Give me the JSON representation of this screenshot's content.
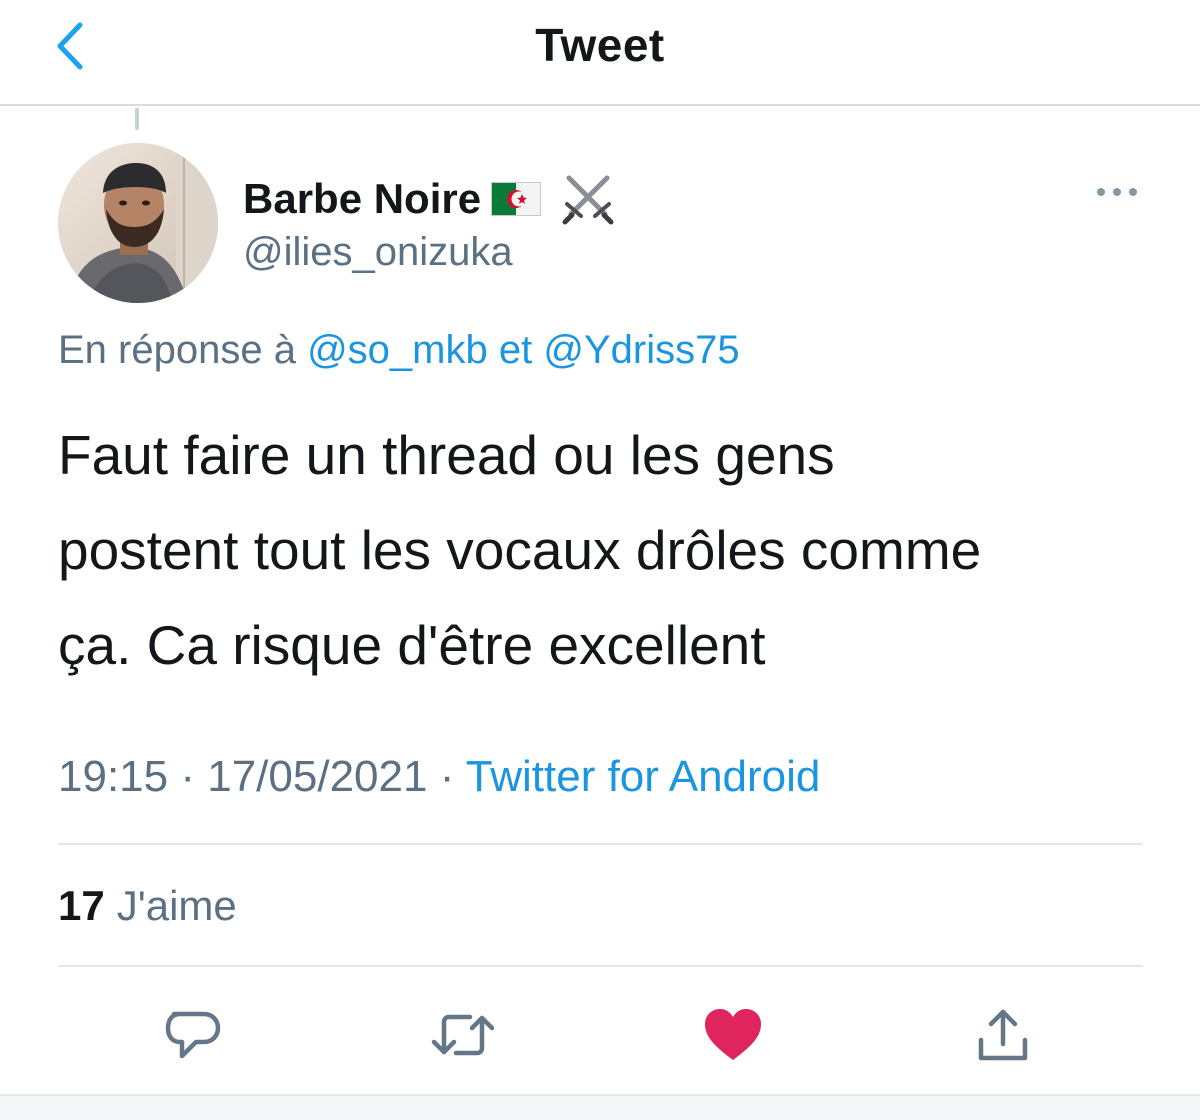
{
  "header": {
    "title": "Tweet",
    "back_icon": "chevron-left-icon",
    "accent": "#1da1f2"
  },
  "tweet": {
    "author": {
      "name": "Barbe Noire",
      "flag_icon": "algeria-flag-icon",
      "emoji_icon": "crossed-swords-icon",
      "handle": "@ilies_onizuka"
    },
    "more_icon": "more-horizontal-icon",
    "reply_context": {
      "prefix": "En réponse à",
      "mention_1": "@so_mkb",
      "joiner": "et",
      "mention_2": "@Ydriss75"
    },
    "text_lines": [
      "Faut faire un thread ou les gens",
      "postent tout les vocaux drôles comme",
      "ça. Ca risque d'être excellent"
    ],
    "time": "19:15",
    "separator": "·",
    "date": "17/05/2021",
    "source": "Twitter for Android",
    "likes": {
      "count": "17",
      "label": "J'aime"
    },
    "actions": [
      {
        "icon": "reply-icon",
        "color": "#657786"
      },
      {
        "icon": "retweet-icon",
        "color": "#657786"
      },
      {
        "icon": "heart-icon",
        "color": "#e0245e"
      },
      {
        "icon": "share-icon",
        "color": "#657786"
      }
    ],
    "colors": {
      "text": "#14171a",
      "secondary": "#5b7083",
      "link": "#1b95e0",
      "liked": "#e0245e"
    }
  }
}
